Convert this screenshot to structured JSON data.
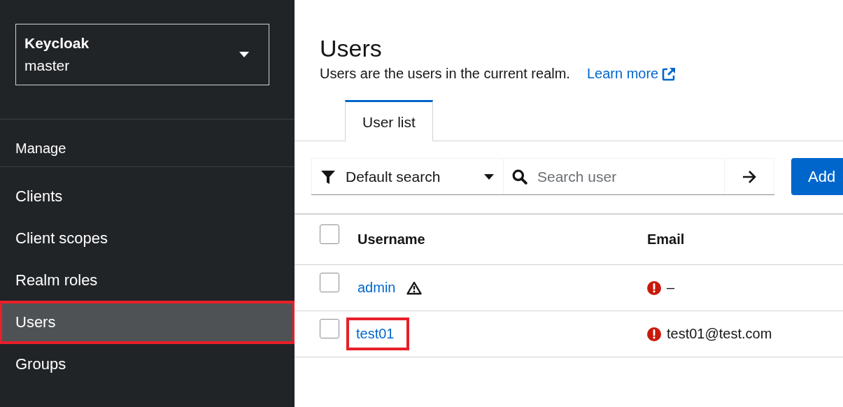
{
  "realm_selector": {
    "title": "Keycloak",
    "realm": "master"
  },
  "sidebar": {
    "section": "Manage",
    "items": [
      {
        "label": "Clients",
        "selected": false,
        "annotated": false
      },
      {
        "label": "Client scopes",
        "selected": false,
        "annotated": false
      },
      {
        "label": "Realm roles",
        "selected": false,
        "annotated": false
      },
      {
        "label": "Users",
        "selected": true,
        "annotated": true
      },
      {
        "label": "Groups",
        "selected": false,
        "annotated": false
      }
    ]
  },
  "page": {
    "title": "Users",
    "description": "Users are the users in the current realm.",
    "learn_more": "Learn more"
  },
  "tabs": [
    {
      "label": "User list",
      "selected": true
    }
  ],
  "toolbar": {
    "filter": "Default search",
    "search": {
      "placeholder": "Search user"
    },
    "add_button": "Add"
  },
  "table": {
    "select_all_checked": false,
    "columns": [
      "Username",
      "Email"
    ],
    "rows": [
      {
        "username": "admin",
        "warning": true,
        "annotated": false,
        "selected": false,
        "email": "–",
        "email_unverified": true
      },
      {
        "username": "test01",
        "warning": false,
        "annotated": true,
        "selected": false,
        "email": "test01@test.com",
        "email_unverified": true
      }
    ]
  }
}
